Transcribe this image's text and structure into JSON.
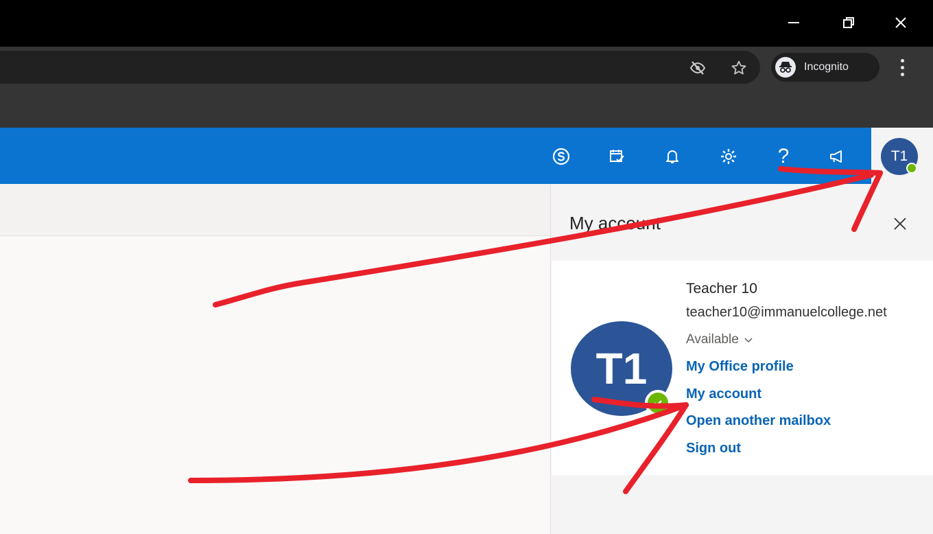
{
  "browser": {
    "window_controls": {
      "minimize": "—",
      "restore": "❐",
      "close": "✕"
    },
    "incognito_label": "Incognito"
  },
  "suite_bar": {
    "icons": [
      "skype-icon",
      "my-day-icon",
      "notifications-icon",
      "settings-icon",
      "help-icon",
      "feedback-icon"
    ],
    "help_glyph": "?",
    "avatar_initials": "T1",
    "accent_color": "#0a74d0",
    "avatar_color": "#2c5597",
    "presence_color": "#6bb700"
  },
  "account_panel": {
    "title": "My account",
    "close_glyph": "✕",
    "avatar_initials": "T1",
    "user_name": "Teacher 10",
    "user_email": "teacher10@immanuelcollege.net",
    "status": "Available",
    "links": [
      "My Office profile",
      "My account",
      "Open another mailbox",
      "Sign out"
    ]
  },
  "annotation_color": "#e8212b"
}
